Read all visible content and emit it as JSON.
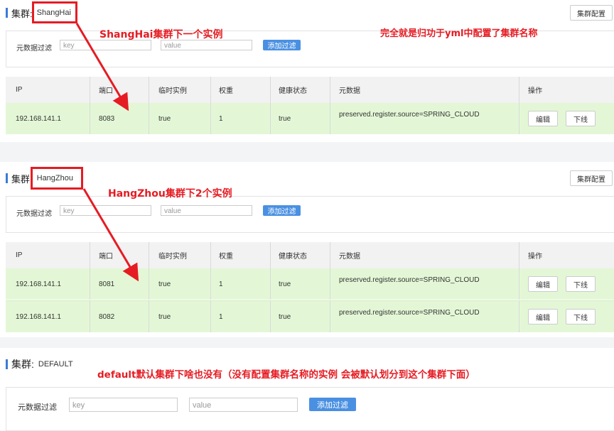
{
  "common": {
    "cluster_label": "集群:",
    "config_button": "集群配置",
    "filter_label": "元数据过滤",
    "key_placeholder": "key",
    "value_placeholder": "value",
    "add_filter_button": "添加过滤",
    "columns": [
      "IP",
      "端口",
      "临时实例",
      "权重",
      "健康状态",
      "元数据",
      "操作"
    ],
    "edit_button": "编辑",
    "offline_button": "下线"
  },
  "clusters": [
    {
      "name": "ShangHai",
      "rows": [
        {
          "ip": "192.168.141.1",
          "port": "8083",
          "ephemeral": "true",
          "weight": "1",
          "healthy": "true",
          "metadata": "preserved.register.source=SPRING_CLOUD"
        }
      ]
    },
    {
      "name": "HangZhou",
      "rows": [
        {
          "ip": "192.168.141.1",
          "port": "8081",
          "ephemeral": "true",
          "weight": "1",
          "healthy": "true",
          "metadata": "preserved.register.source=SPRING_CLOUD"
        },
        {
          "ip": "192.168.141.1",
          "port": "8082",
          "ephemeral": "true",
          "weight": "1",
          "healthy": "true",
          "metadata": "preserved.register.source=SPRING_CLOUD"
        }
      ]
    },
    {
      "name": "DEFAULT",
      "rows": []
    }
  ],
  "annotations": {
    "shanghai": "ShangHai集群下一个实例",
    "top_right": "完全就是归功于yml中配置了集群名称",
    "hangzhou": "HangZhou集群下2个实例",
    "default": "default默认集群下啥也没有（没有配置集群名称的实例 会被默认划分到这个集群下面）"
  },
  "colors": {
    "accent": "#3a7bd5",
    "add_button": "#4a90e2",
    "row_bg": "#e3f7d6",
    "annotation": "#e51c23"
  }
}
